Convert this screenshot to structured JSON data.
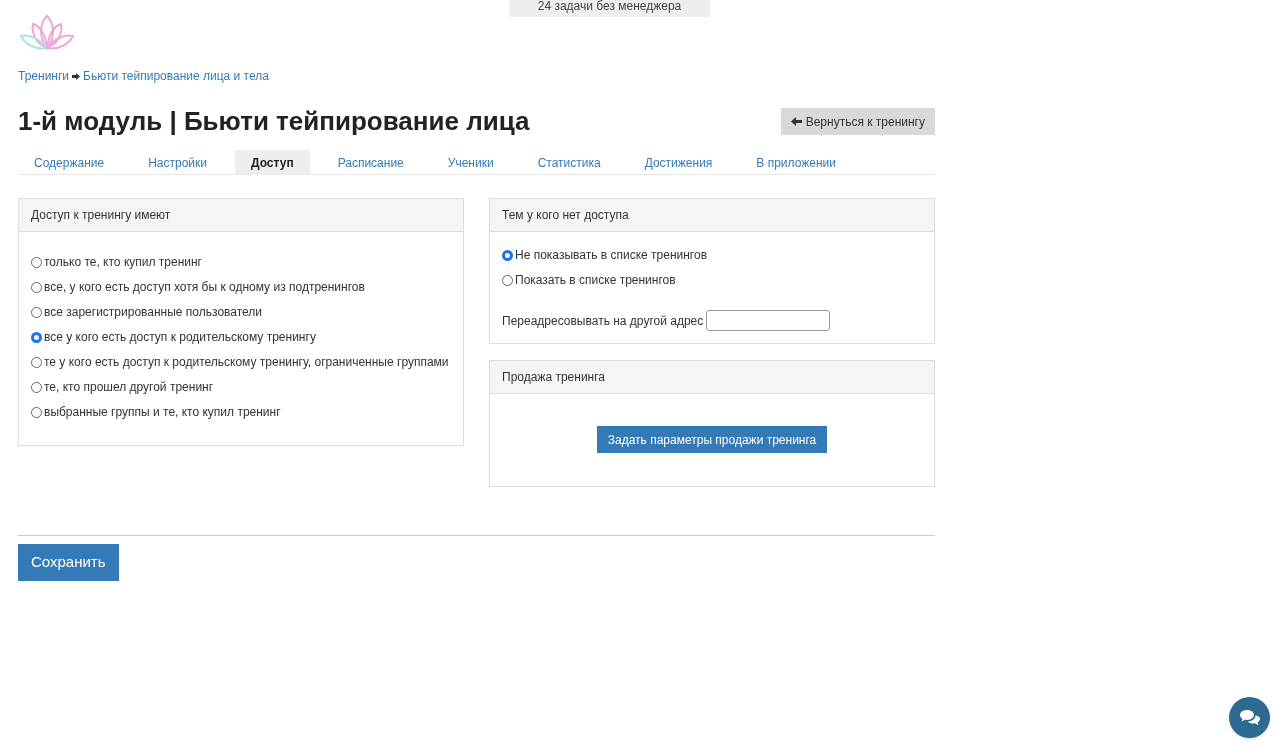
{
  "top_badge": "24 задачи без менеджера",
  "breadcrumbs": [
    "Тренинги",
    "Бьюти тейпирование лица и тела"
  ],
  "title": "1-й модуль | Бьюти тейпирование лица",
  "back_button": "Вернуться к тренингу",
  "tabs": [
    {
      "label": "Содержание",
      "selected": false
    },
    {
      "label": "Настройки",
      "selected": false
    },
    {
      "label": "Доступ",
      "selected": true
    },
    {
      "label": "Расписание",
      "selected": false
    },
    {
      "label": "Ученики",
      "selected": false
    },
    {
      "label": "Статистика",
      "selected": false
    },
    {
      "label": "Достижения",
      "selected": false
    },
    {
      "label": "В приложении",
      "selected": false
    }
  ],
  "access_panel": {
    "title": "Доступ к тренингу имеют",
    "options": [
      {
        "label": "только те, кто купил тренинг",
        "selected": false
      },
      {
        "label": "все, у кого есть доступ хотя бы к одному из подтренингов",
        "selected": false
      },
      {
        "label": "все зарегистрированные пользователи",
        "selected": false
      },
      {
        "label": "все у кого есть доступ к родительскому тренингу",
        "selected": true
      },
      {
        "label": "те у кого есть доступ к родительскому тренингу, ограниченные группами",
        "selected": false
      },
      {
        "label": "те, кто прошел другой тренинг",
        "selected": false
      },
      {
        "label": "выбранные группы и те, кто купил тренинг",
        "selected": false
      }
    ]
  },
  "no_access_panel": {
    "title": "Тем у кого нет доступа",
    "options": [
      {
        "label": "Не показывать в списке тренингов",
        "selected": true
      },
      {
        "label": "Показать в списке тренингов",
        "selected": false
      }
    ],
    "redirect_label": "Переадресовывать на другой адрес"
  },
  "sale_panel": {
    "title": "Продажа тренинга",
    "button": "Задать параметры продажи тренинга"
  },
  "save_button": "Сохранить"
}
